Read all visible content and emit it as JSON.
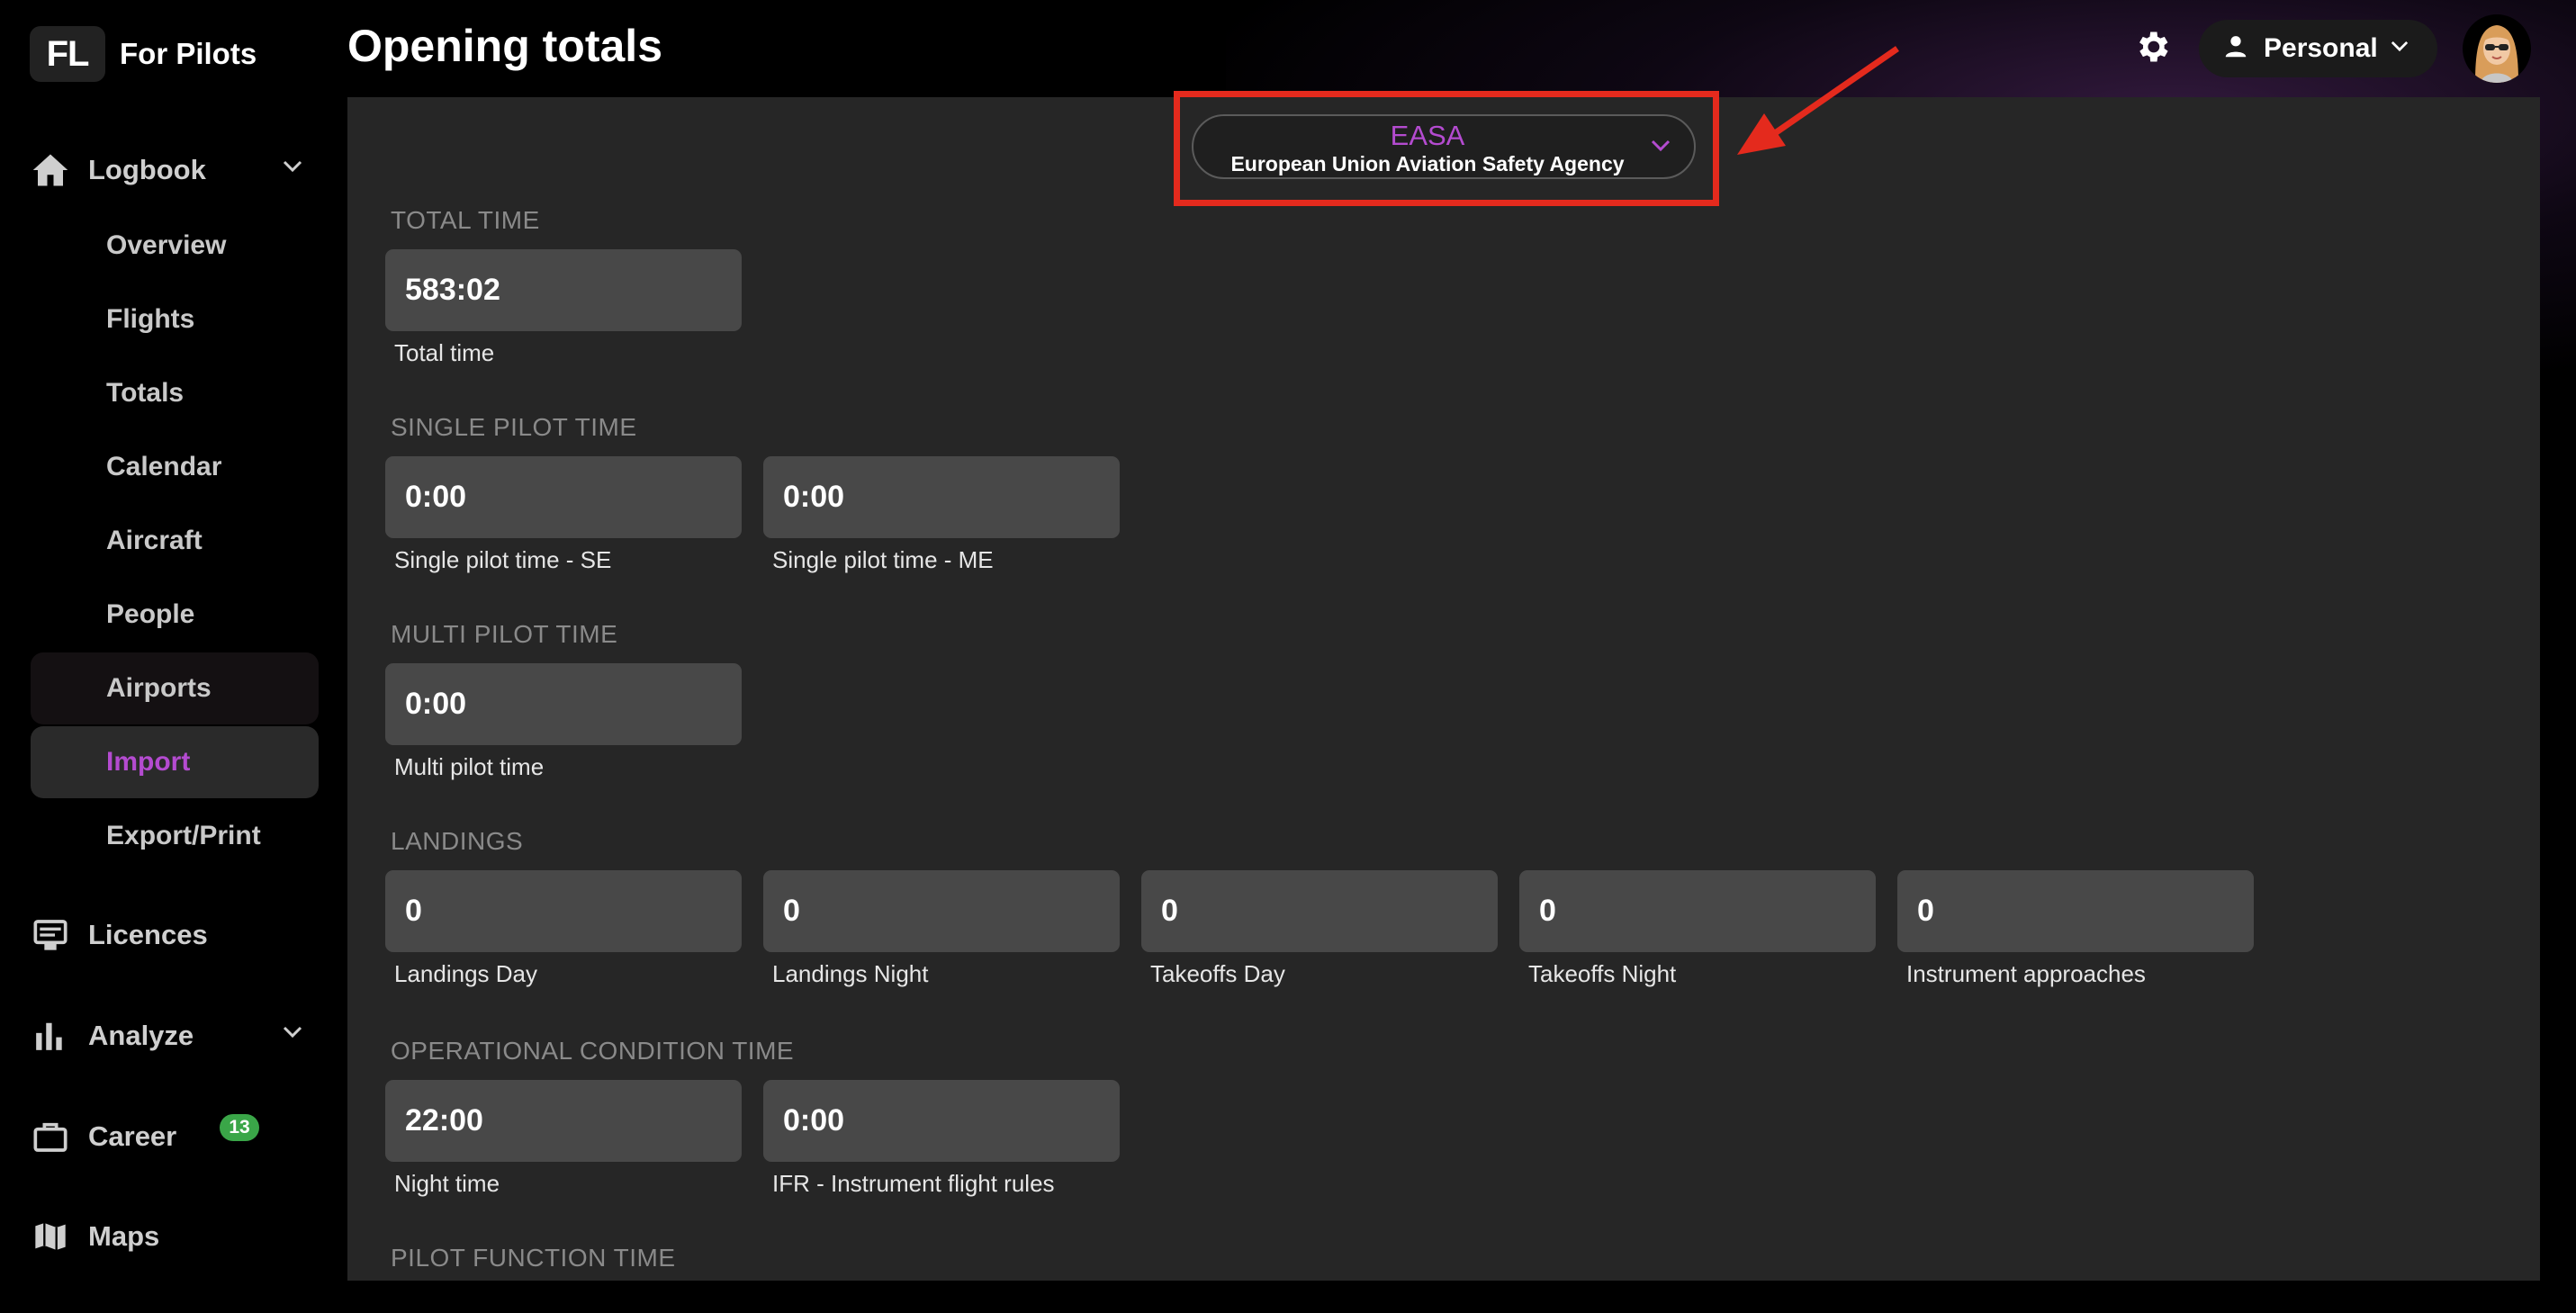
{
  "brand": {
    "logo": "FL",
    "name": "For Pilots"
  },
  "sidebar": {
    "logbook_label": "Logbook",
    "items": [
      {
        "label": "Overview"
      },
      {
        "label": "Flights"
      },
      {
        "label": "Totals"
      },
      {
        "label": "Calendar"
      },
      {
        "label": "Aircraft"
      },
      {
        "label": "People"
      },
      {
        "label": "Airports"
      },
      {
        "label": "Import"
      },
      {
        "label": "Export/Print"
      }
    ],
    "licences_label": "Licences",
    "analyze_label": "Analyze",
    "career_label": "Career",
    "career_badge": "13",
    "maps_label": "Maps"
  },
  "header": {
    "title": "Opening totals",
    "profile_label": "Personal",
    "settings_icon": "gear-icon",
    "profile_icon": "person-icon"
  },
  "authority": {
    "code": "EASA",
    "name": "European Union Aviation Safety Agency"
  },
  "sections": {
    "total_time": {
      "title": "TOTAL TIME",
      "fields": [
        {
          "value": "583:02",
          "label": "Total time"
        }
      ]
    },
    "single_pilot": {
      "title": "SINGLE PILOT TIME",
      "fields": [
        {
          "value": "0:00",
          "label": "Single pilot time - SE"
        },
        {
          "value": "0:00",
          "label": "Single pilot time - ME"
        }
      ]
    },
    "multi_pilot": {
      "title": "MULTI PILOT TIME",
      "fields": [
        {
          "value": "0:00",
          "label": "Multi pilot time"
        }
      ]
    },
    "landings": {
      "title": "LANDINGS",
      "fields": [
        {
          "value": "0",
          "label": "Landings Day"
        },
        {
          "value": "0",
          "label": "Landings Night"
        },
        {
          "value": "0",
          "label": "Takeoffs Day"
        },
        {
          "value": "0",
          "label": "Takeoffs Night"
        },
        {
          "value": "0",
          "label": "Instrument approaches"
        }
      ]
    },
    "operational": {
      "title": "OPERATIONAL CONDITION TIME",
      "fields": [
        {
          "value": "22:00",
          "label": "Night time"
        },
        {
          "value": "0:00",
          "label": "IFR - Instrument flight rules"
        }
      ]
    },
    "pilot_function": {
      "title": "PILOT FUNCTION TIME"
    }
  },
  "colors": {
    "accent": "#b44bd0",
    "highlight": "#e42a1d",
    "badge": "#3aa648",
    "panel": "#262626",
    "field": "#484848"
  }
}
